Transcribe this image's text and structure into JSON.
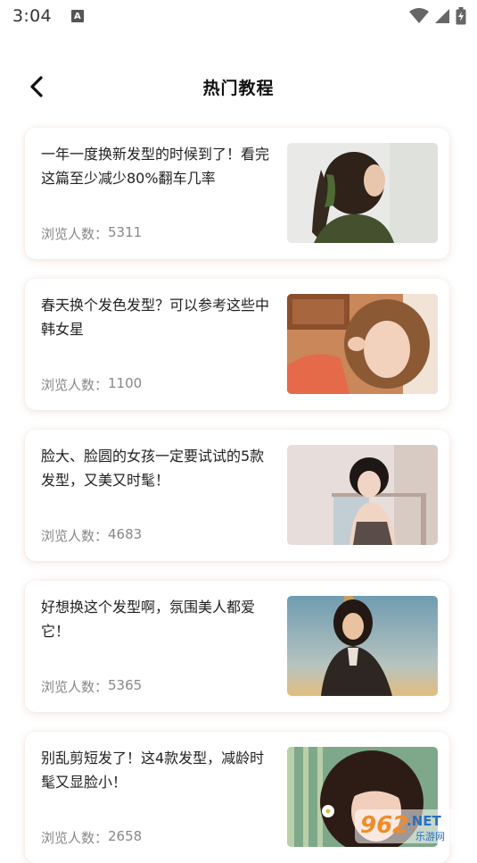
{
  "status_bar": {
    "time": "3:04",
    "notification_icon": "a-letter-icon",
    "icons": [
      "wifi-icon",
      "signal-icon",
      "battery-icon"
    ]
  },
  "header": {
    "title": "热门教程",
    "back_icon": "chevron-left-icon"
  },
  "views_label": "浏览人数：",
  "articles": [
    {
      "title": "一年一度换新发型的时候到了！看完这篇至少减少80%翻车几率",
      "views": "5311"
    },
    {
      "title": "春天换个发色发型？可以参考这些中韩女星",
      "views": "1100"
    },
    {
      "title": "脸大、脸圆的女孩一定要试试的5款发型，又美又时髦！",
      "views": "4683"
    },
    {
      "title": "好想换这个发型啊，氛围美人都爱它！",
      "views": "5365"
    },
    {
      "title": "别乱剪短发了！这4款发型，减龄时髦又显脸小！",
      "views": "2658"
    }
  ],
  "watermark": {
    "brand": "962",
    "net": ".NET",
    "sub": "乐游网"
  },
  "colors": {
    "card_shadow": "#be9678",
    "views_text": "#888888",
    "title_text": "#222222"
  }
}
